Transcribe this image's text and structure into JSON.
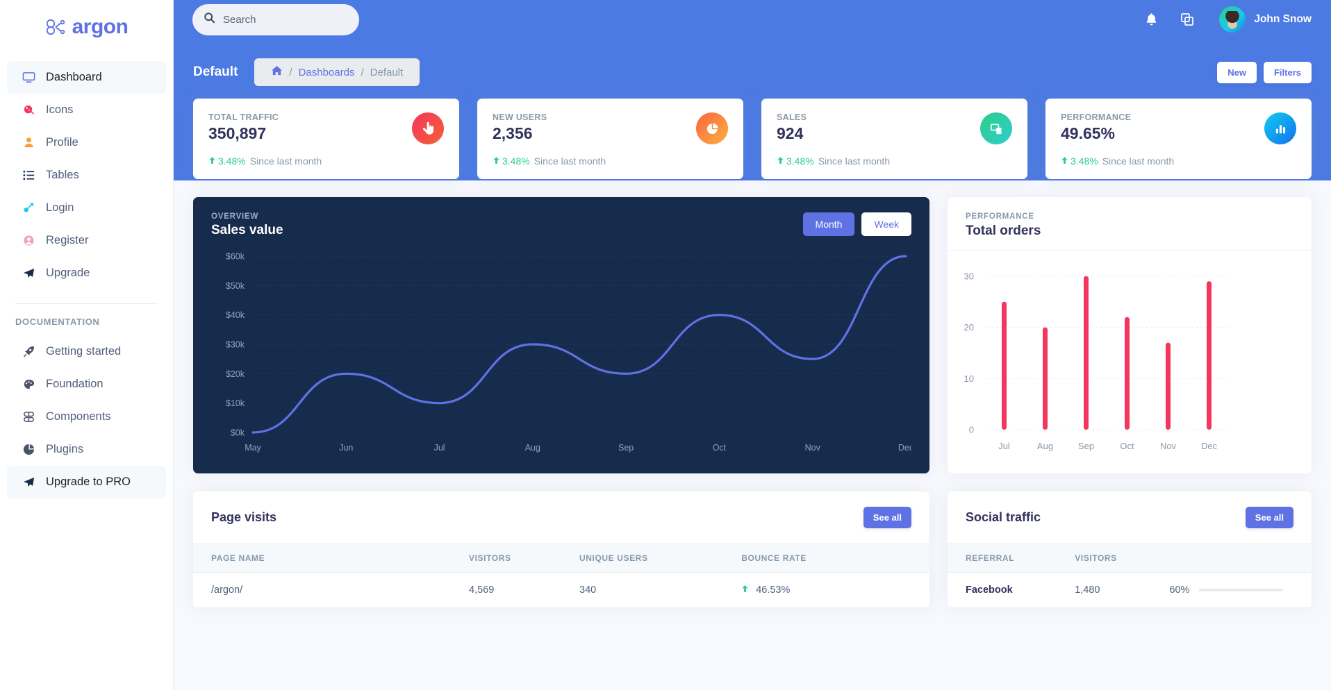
{
  "brand": {
    "name": "argon",
    "logo_icon": "argon-logo-icon",
    "color": "#5e72e4"
  },
  "sidebar": {
    "items": [
      {
        "label": "Dashboard",
        "icon": "tv-screen-icon",
        "active": true
      },
      {
        "label": "Icons",
        "icon": "planet-icon",
        "active": false
      },
      {
        "label": "Profile",
        "icon": "user-icon",
        "active": false
      },
      {
        "label": "Tables",
        "icon": "bullet-list-icon",
        "active": false
      },
      {
        "label": "Login",
        "icon": "key-icon",
        "active": false
      },
      {
        "label": "Register",
        "icon": "circle-user-icon",
        "active": false
      },
      {
        "label": "Upgrade",
        "icon": "paper-plane-icon",
        "active": false
      }
    ],
    "section_heading": "DOCUMENTATION",
    "doc_items": [
      {
        "label": "Getting started",
        "icon": "rocket-icon",
        "active": false
      },
      {
        "label": "Foundation",
        "icon": "palette-icon",
        "active": false
      },
      {
        "label": "Components",
        "icon": "components-icon",
        "active": false
      },
      {
        "label": "Plugins",
        "icon": "pie-chart-icon",
        "active": false
      },
      {
        "label": "Upgrade to PRO",
        "icon": "paper-plane-icon",
        "active": true
      }
    ]
  },
  "navbar": {
    "search": {
      "placeholder": "Search",
      "value": "",
      "icon": "search-icon"
    },
    "bell_icon": "bell-icon",
    "apps_icon": "copy-windows-icon",
    "user": {
      "name": "John Snow",
      "avatar": "user-avatar"
    }
  },
  "page_header": {
    "title": "Default",
    "breadcrumb": {
      "home_icon": "home-icon",
      "separator": "/",
      "link": "Dashboards",
      "current": "Default"
    },
    "actions": [
      {
        "label": "New",
        "name": "new-button"
      },
      {
        "label": "Filters",
        "name": "filters-button"
      }
    ]
  },
  "stats": [
    {
      "label": "TOTAL TRAFFIC",
      "value": "350,897",
      "delta": "3.48%",
      "delta_dir": "up",
      "since": "Since last month",
      "icon": "hand-pointer-icon",
      "color_from": "#f5365c",
      "color_to": "#f56036"
    },
    {
      "label": "NEW USERS",
      "value": "2,356",
      "delta": "3.48%",
      "delta_dir": "up",
      "since": "Since last month",
      "icon": "pie-chart-icon",
      "color_from": "#fb6340",
      "color_to": "#fbb140"
    },
    {
      "label": "SALES",
      "value": "924",
      "delta": "3.48%",
      "delta_dir": "up",
      "since": "Since last month",
      "icon": "coins-stack-icon",
      "color_from": "#2dce89",
      "color_to": "#2dcecc"
    },
    {
      "label": "PERFORMANCE",
      "value": "49.65%",
      "delta": "3.48%",
      "delta_dir": "up",
      "since": "Since last month",
      "icon": "bar-chart-icon",
      "color_from": "#11cdef",
      "color_to": "#1171ef"
    }
  ],
  "sales_chart": {
    "eyebrow": "OVERVIEW",
    "title": "Sales value",
    "toggles": [
      {
        "label": "Month",
        "selected": true
      },
      {
        "label": "Week",
        "selected": false
      }
    ]
  },
  "orders_chart": {
    "eyebrow": "PERFORMANCE",
    "title": "Total orders"
  },
  "chart_data": [
    {
      "type": "line",
      "title": "Sales value",
      "subtitle": "OVERVIEW",
      "x": [
        "May",
        "Jun",
        "Jul",
        "Aug",
        "Sep",
        "Oct",
        "Nov",
        "Dec"
      ],
      "series": [
        {
          "name": "Sales value",
          "values": [
            0,
            20000,
            10000,
            30000,
            20000,
            40000,
            25000,
            60000
          ]
        }
      ],
      "ylabel": "",
      "xlabel": "",
      "ylim": [
        0,
        60000
      ],
      "ytick_labels": [
        "$0k",
        "$10k",
        "$20k",
        "$30k",
        "$40k",
        "$50k",
        "$60k"
      ],
      "ytick_values": [
        0,
        10000,
        20000,
        30000,
        40000,
        50000,
        60000
      ],
      "grid": true,
      "legend": "none",
      "line_color": "#5e72e4",
      "background": "#172b4d"
    },
    {
      "type": "bar",
      "title": "Total orders",
      "subtitle": "PERFORMANCE",
      "categories": [
        "Jul",
        "Aug",
        "Sep",
        "Oct",
        "Nov",
        "Dec"
      ],
      "values": [
        25,
        20,
        30,
        22,
        17,
        29
      ],
      "ylabel": "",
      "xlabel": "",
      "ylim": [
        0,
        32
      ],
      "ytick_labels": [
        "0",
        "10",
        "20",
        "30"
      ],
      "ytick_values": [
        0,
        10,
        20,
        30
      ],
      "grid": true,
      "legend": "none",
      "bar_color": "#f5365c",
      "background": "#ffffff"
    }
  ],
  "page_visits": {
    "title": "Page visits",
    "see_all": "See all",
    "columns": [
      "PAGE NAME",
      "VISITORS",
      "UNIQUE USERS",
      "BOUNCE RATE"
    ],
    "rows": [
      {
        "page": "/argon/",
        "visitors": "4,569",
        "unique": "340",
        "bounce": "46.53%",
        "dir": "up"
      }
    ]
  },
  "social_traffic": {
    "title": "Social traffic",
    "see_all": "See all",
    "columns": [
      "REFERRAL",
      "VISITORS",
      ""
    ],
    "rows": [
      {
        "referral": "Facebook",
        "visitors": "1,480",
        "pct": "60%",
        "pct_value": 60
      }
    ]
  }
}
